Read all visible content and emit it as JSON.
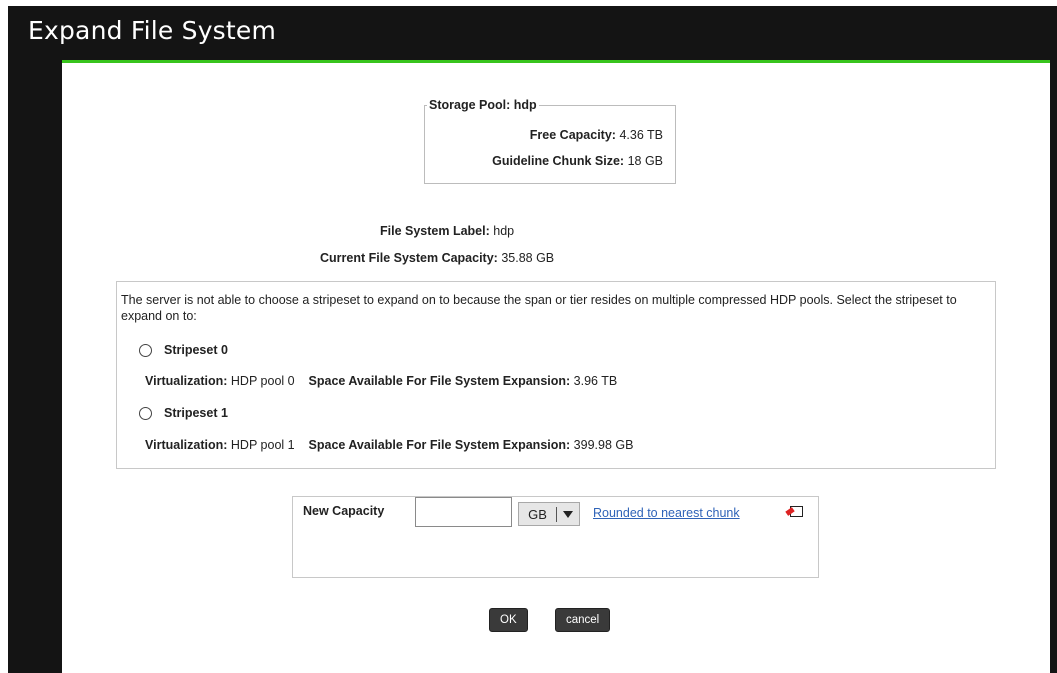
{
  "window": {
    "title": "Expand File System"
  },
  "storage_pool": {
    "legend": "Storage Pool: hdp",
    "free_capacity_label": "Free Capacity:",
    "free_capacity_value": "4.36 TB",
    "chunk_size_label": "Guideline Chunk Size:",
    "chunk_size_value": "18 GB"
  },
  "file_system": {
    "label_label": "File System Label:",
    "label_value": "hdp",
    "capacity_label": "Current File System Capacity:",
    "capacity_value": "35.88 GB"
  },
  "stripesets": {
    "message": "The server is not able to choose a stripeset to expand on to because the span or tier resides on multiple compressed HDP pools. Select the stripeset to expand on to:",
    "items": [
      {
        "name": "Stripeset 0",
        "virtualization_label": "Virtualization:",
        "virtualization_value": "HDP pool 0",
        "space_label": "Space Available For File System Expansion:",
        "space_value": "3.96 TB",
        "selected": false
      },
      {
        "name": "Stripeset 1",
        "virtualization_label": "Virtualization:",
        "virtualization_value": "HDP pool 1",
        "space_label": "Space Available For File System Expansion:",
        "space_value": "399.98 GB",
        "selected": false
      }
    ]
  },
  "new_capacity": {
    "label": "New Capacity",
    "value": "",
    "unit": "GB",
    "link": "Rounded to nearest chunk"
  },
  "buttons": {
    "ok": "OK",
    "cancel": "cancel"
  },
  "colors": {
    "title_bar": "#141414",
    "accent": "#38c41c",
    "link": "#2f63b8",
    "button": "#3a3a3a"
  }
}
